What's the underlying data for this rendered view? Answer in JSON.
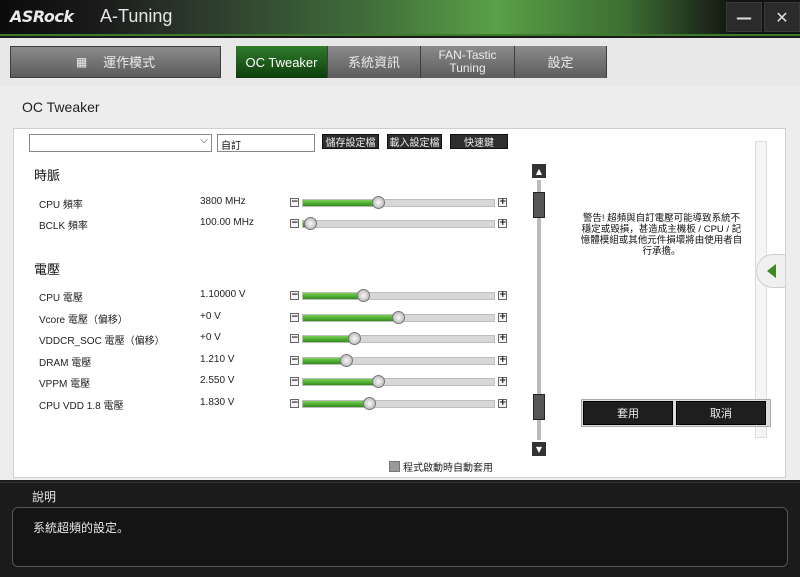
{
  "titlebar": {
    "brand": "ASRock",
    "app_title": "A-Tuning",
    "minimize": "—",
    "close": "✕"
  },
  "nav": {
    "mode": "運作模式",
    "tabs": [
      "OC Tweaker",
      "系統資訊",
      "FAN-Tastic Tuning",
      "設定"
    ],
    "active": "OC Tweaker"
  },
  "page_title": "OC Tweaker",
  "toolbar": {
    "profile_select_value": "",
    "profile_name": "自訂",
    "save_label": "儲存設定檔",
    "load_label": "載入設定檔",
    "hotkey_label": "快速鍵"
  },
  "sections": {
    "clock": "時脈",
    "voltage": "電壓"
  },
  "clock_rows": [
    {
      "label": "CPU 頻率",
      "value": "3800 MHz",
      "level": 0.4
    },
    {
      "label": "BCLK 頻率",
      "value": "100.00 MHz",
      "level": 0.04
    }
  ],
  "voltage_rows": [
    {
      "label": "CPU 電壓",
      "value": "1.10000 V",
      "level": 0.32
    },
    {
      "label": "Vcore 電壓（偏移）",
      "value": "+0 V",
      "level": 0.5
    },
    {
      "label": "VDDCR_SOC 電壓（偏移）",
      "value": "+0 V",
      "level": 0.27
    },
    {
      "label": "DRAM 電壓",
      "value": "1.210 V",
      "level": 0.23
    },
    {
      "label": "VPPM 電壓",
      "value": "2.550 V",
      "level": 0.4
    },
    {
      "label": "CPU VDD 1.8 電壓",
      "value": "1.830 V",
      "level": 0.35
    }
  ],
  "warning": "警告! 超頻與自訂電壓可能導致系統不穩定或毀損，甚造成主機板 / CPU / 記憶體模組或其他元件損壞將由使用者自行承擔。",
  "auto_apply_label": "程式啟動時自動套用",
  "apply_label": "套用",
  "cancel_label": "取消",
  "description": {
    "title": "說明",
    "text": "系統超頻的設定。"
  },
  "colors": {
    "accent_green": "#3d8a20",
    "title_bar_dark": "#121212"
  },
  "icons": {
    "mode": "grid-icon",
    "dropdown": "chevron-down-icon",
    "side": "chevron-left-icon"
  }
}
